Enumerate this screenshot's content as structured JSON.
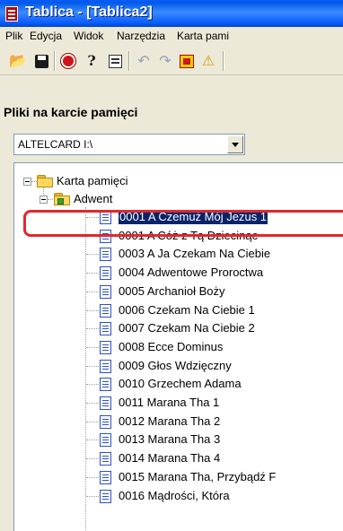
{
  "window": {
    "title": "Tablica - [Tablica2]"
  },
  "menu": [
    "Plik",
    "Edycja",
    "Widok",
    "Narzędzia",
    "Karta pami"
  ],
  "toolbar": [
    {
      "name": "open-folder-icon",
      "glyph": "📂"
    },
    {
      "name": "save-icon",
      "glyph": "💾"
    },
    {
      "name": "stop-icon",
      "glyph": "⛔"
    },
    {
      "name": "help-icon",
      "glyph": "?"
    },
    {
      "name": "properties-icon",
      "glyph": "📋"
    },
    {
      "name": "undo-icon",
      "glyph": "↶"
    },
    {
      "name": "redo-icon",
      "glyph": "↷"
    },
    {
      "name": "card-icon",
      "glyph": "▤"
    },
    {
      "name": "warning-icon",
      "glyph": "⚠"
    }
  ],
  "panel": {
    "title": "Pliki na karcie pamięci",
    "drive": {
      "selected": "ALTELCARD I:\\"
    }
  },
  "tree": {
    "root": {
      "label": "Karta pamięci",
      "expanded": true
    },
    "folder": {
      "label": "Adwent",
      "expanded": true
    },
    "selected_index": 0,
    "files": [
      "0001 A Czemuż Mój Jezus 1",
      "0001 A Cóż z Tą Dziecinąc",
      "0003 A Ja Czekam Na Ciebie",
      "0004 Adwentowe Proroctwa",
      "0005 Archanioł Boży",
      "0006 Czekam Na Ciebie 1",
      "0007 Czekam Na Ciebie 2",
      "0008 Ecce Dominus",
      "0009 Głos Wdzięczny",
      "0010 Grzechem Adama",
      "0011 Marana Tha 1",
      "0012 Marana Tha 2",
      "0013 Marana Tha 3",
      "0014 Marana Tha 4",
      "0015 Marana Tha, Przybądź F",
      "0016 Mądrości, Która"
    ]
  },
  "colors": {
    "title_bar": "#0a5cff",
    "selection": "#0a246a",
    "highlight_box": "#e0282e"
  }
}
